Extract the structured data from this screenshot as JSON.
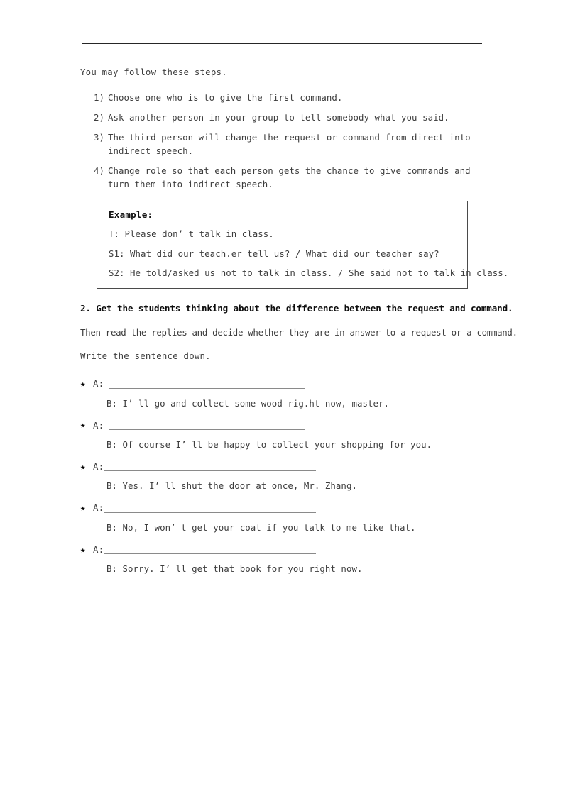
{
  "document": {
    "intro": "You may follow these steps.",
    "steps": [
      {
        "num": "1)",
        "text": "Choose one who is to give the first command."
      },
      {
        "num": "2)",
        "text": "Ask another person in your group to tell somebody what you said."
      },
      {
        "num": "3)",
        "text": "The third person will change the request or command from direct into indirect speech."
      },
      {
        "num": "4)",
        "text": "Change role so that each person gets the chance to give commands and turn them into indirect speech."
      }
    ],
    "example_box": {
      "title": "Example:",
      "lines": [
        "T: Please don’ t talk in class.",
        "S1: What did our teach.er tell us? / What did our teacher say?",
        "S2: He told/asked us not to talk in class. / She said not to talk in class."
      ]
    },
    "section": {
      "heading": "2. Get the students thinking about the difference between the request and command.",
      "lead_line_1": "Then read the replies and decide whether they are in answer to a request or a command.",
      "lead_line_2": "Write the sentence down."
    },
    "dialogue": {
      "bullet_icon": "★",
      "a_label": "A:",
      "items": [
        {
          "a_label": "A:",
          "blank_width": 275,
          "blank_spaced": true,
          "b": "B: I’ ll go and collect some wood rig.ht now, master."
        },
        {
          "a_label": "A:",
          "blank_width": 275,
          "blank_spaced": true,
          "b": "B: Of course I’ ll be happy to collect your shopping for you."
        },
        {
          "a_label": "A:",
          "blank_width": 298,
          "blank_spaced": false,
          "b": "B: Yes. I’ ll shut the door at once, Mr. Zhang."
        },
        {
          "a_label": "A:",
          "blank_width": 298,
          "blank_spaced": false,
          "b": "B: No, I won’ t get your coat if you talk to me like that."
        },
        {
          "a_label": "A:",
          "blank_width": 298,
          "blank_spaced": false,
          "b": "B: Sorry. I’ ll get that book for you right now."
        }
      ]
    }
  }
}
